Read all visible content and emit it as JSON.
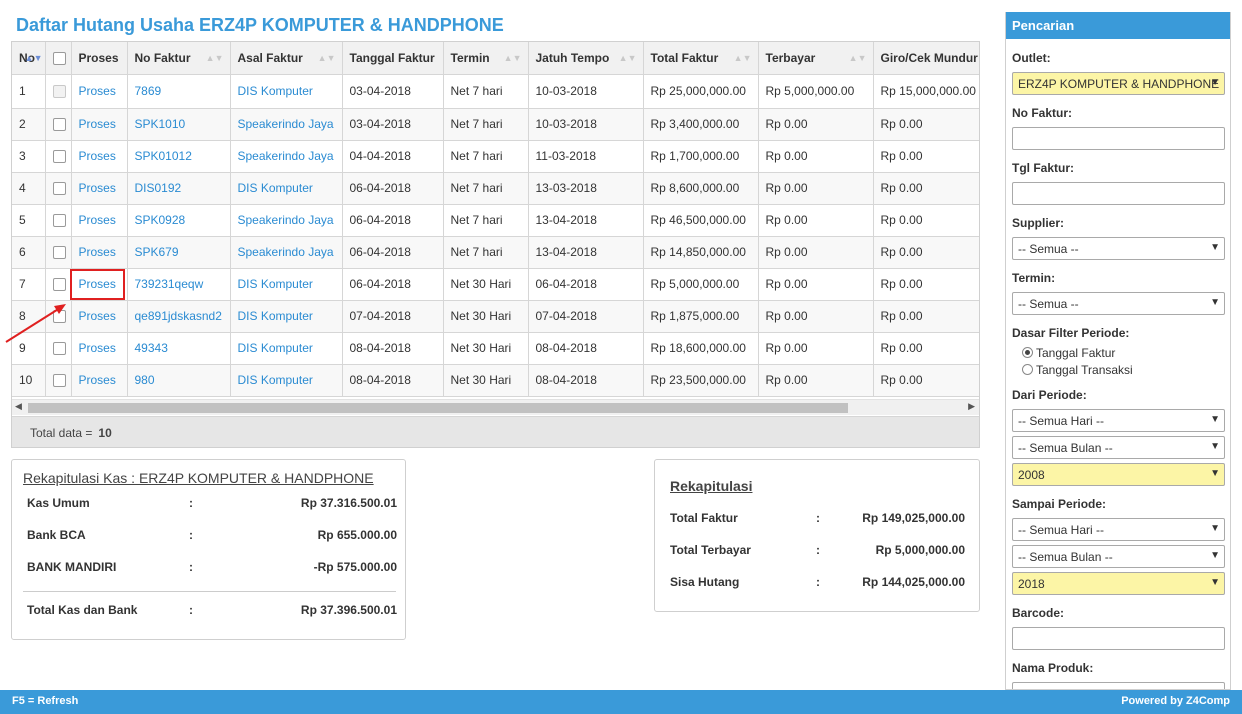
{
  "page_title": "Daftar Hutang Usaha ERZ4P KOMPUTER & HANDPHONE",
  "table": {
    "headers": [
      "No",
      "",
      "Proses",
      "No Faktur",
      "Asal Faktur",
      "Tanggal Faktur",
      "Termin",
      "Jatuh Tempo",
      "Total Faktur",
      "Terbayar",
      "Giro/Cek Mundur"
    ],
    "rows": [
      {
        "no": "1",
        "proses": "Proses",
        "no_faktur": "7869",
        "asal": "DIS Komputer",
        "tgl": "03-04-2018",
        "termin": "Net 7 hari",
        "jatuh": "10-03-2018",
        "total": "Rp 25,000,000.00",
        "terbayar": "Rp 5,000,000.00",
        "giro": "Rp 15,000,000.00"
      },
      {
        "no": "2",
        "proses": "Proses",
        "no_faktur": "SPK1010",
        "asal": "Speakerindo Jaya",
        "tgl": "03-04-2018",
        "termin": "Net 7 hari",
        "jatuh": "10-03-2018",
        "total": "Rp 3,400,000.00",
        "terbayar": "Rp 0.00",
        "giro": "Rp 0.00"
      },
      {
        "no": "3",
        "proses": "Proses",
        "no_faktur": "SPK01012",
        "asal": "Speakerindo Jaya",
        "tgl": "04-04-2018",
        "termin": "Net 7 hari",
        "jatuh": "11-03-2018",
        "total": "Rp 1,700,000.00",
        "terbayar": "Rp 0.00",
        "giro": "Rp 0.00"
      },
      {
        "no": "4",
        "proses": "Proses",
        "no_faktur": "DIS0192",
        "asal": "DIS Komputer",
        "tgl": "06-04-2018",
        "termin": "Net 7 hari",
        "jatuh": "13-03-2018",
        "total": "Rp 8,600,000.00",
        "terbayar": "Rp 0.00",
        "giro": "Rp 0.00"
      },
      {
        "no": "5",
        "proses": "Proses",
        "no_faktur": "SPK0928",
        "asal": "Speakerindo Jaya",
        "tgl": "06-04-2018",
        "termin": "Net 7 hari",
        "jatuh": "13-04-2018",
        "total": "Rp 46,500,000.00",
        "terbayar": "Rp 0.00",
        "giro": "Rp 0.00"
      },
      {
        "no": "6",
        "proses": "Proses",
        "no_faktur": "SPK679",
        "asal": "Speakerindo Jaya",
        "tgl": "06-04-2018",
        "termin": "Net 7 hari",
        "jatuh": "13-04-2018",
        "total": "Rp 14,850,000.00",
        "terbayar": "Rp 0.00",
        "giro": "Rp 0.00"
      },
      {
        "no": "7",
        "proses": "Proses",
        "no_faktur": "739231qeqw",
        "asal": "DIS Komputer",
        "tgl": "06-04-2018",
        "termin": "Net 30 Hari",
        "jatuh": "06-04-2018",
        "total": "Rp 5,000,000.00",
        "terbayar": "Rp 0.00",
        "giro": "Rp 0.00"
      },
      {
        "no": "8",
        "proses": "Proses",
        "no_faktur": "qe891jdskasnd2",
        "asal": "DIS Komputer",
        "tgl": "07-04-2018",
        "termin": "Net 30 Hari",
        "jatuh": "07-04-2018",
        "total": "Rp 1,875,000.00",
        "terbayar": "Rp 0.00",
        "giro": "Rp 0.00"
      },
      {
        "no": "9",
        "proses": "Proses",
        "no_faktur": "49343",
        "asal": "DIS Komputer",
        "tgl": "08-04-2018",
        "termin": "Net 30 Hari",
        "jatuh": "08-04-2018",
        "total": "Rp 18,600,000.00",
        "terbayar": "Rp 0.00",
        "giro": "Rp 0.00"
      },
      {
        "no": "10",
        "proses": "Proses",
        "no_faktur": "980",
        "asal": "DIS Komputer",
        "tgl": "08-04-2018",
        "termin": "Net 30 Hari",
        "jatuh": "08-04-2018",
        "total": "Rp 23,500,000.00",
        "terbayar": "Rp 0.00",
        "giro": "Rp 0.00"
      }
    ],
    "footer_label": "Total data =",
    "footer_count": "10"
  },
  "kas": {
    "title": "Rekapitulasi Kas : ERZ4P KOMPUTER & HANDPHONE",
    "items": [
      {
        "label": "Kas Umum",
        "colon": ":",
        "value": "Rp 37.316.500.01"
      },
      {
        "label": "Bank BCA",
        "colon": ":",
        "value": "Rp 655.000.00"
      },
      {
        "label": "BANK MANDIRI",
        "colon": ":",
        "value": "-Rp 575.000.00"
      }
    ],
    "total": {
      "label": "Total Kas dan Bank",
      "colon": ":",
      "value": "Rp 37.396.500.01"
    }
  },
  "rekap": {
    "title": "Rekapitulasi",
    "items": [
      {
        "label": "Total Faktur",
        "colon": ":",
        "value": "Rp 149,025,000.00"
      },
      {
        "label": "Total Terbayar",
        "colon": ":",
        "value": "Rp 5,000,000.00"
      },
      {
        "label": "Sisa Hutang",
        "colon": ":",
        "value": "Rp 144,025,000.00"
      }
    ]
  },
  "sidebar": {
    "title": "Pencarian",
    "outlet_label": "Outlet:",
    "outlet_value": "ERZ4P KOMPUTER & HANDPHONE",
    "no_faktur_label": "No Faktur:",
    "tgl_faktur_label": "Tgl Faktur:",
    "supplier_label": "Supplier:",
    "supplier_value": "-- Semua --",
    "termin_label": "Termin:",
    "termin_value": "-- Semua --",
    "dasar_label": "Dasar Filter Periode:",
    "radio_1": "Tanggal Faktur",
    "radio_2": "Tanggal Transaksi",
    "dari_label": "Dari Periode:",
    "dari_hari": "-- Semua Hari --",
    "dari_bulan": "-- Semua Bulan --",
    "dari_tahun": "2008",
    "sampai_label": "Sampai Periode:",
    "sampai_hari": "-- Semua Hari --",
    "sampai_bulan": "-- Semua Bulan --",
    "sampai_tahun": "2018",
    "barcode_label": "Barcode:",
    "nama_produk_label": "Nama Produk:"
  },
  "status_bar": {
    "left": "F5 = Refresh",
    "right": "Powered by Z4Comp"
  },
  "colors": {
    "accent": "#3a9ad9",
    "link": "#2a8bd2",
    "highlight": "#e02020",
    "select_yellow": "#fcf5a6"
  }
}
